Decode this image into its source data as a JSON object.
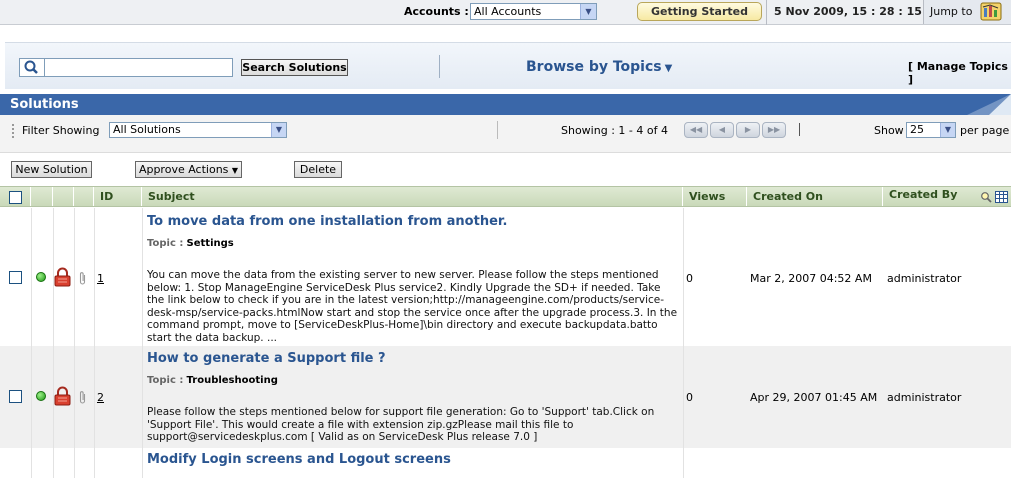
{
  "topbar": {
    "accounts_label": "Accounts :",
    "accounts_value": "All Accounts",
    "getting_started": "Getting Started",
    "datetime": "5 Nov 2009, 15 : 28 : 15",
    "jump_to": "Jump to"
  },
  "search": {
    "placeholder": "",
    "value": "",
    "button": "Search Solutions",
    "browse_topics": "Browse by Topics",
    "manage_topics": "[ Manage Topics ]"
  },
  "solutions": {
    "title": "Solutions"
  },
  "filter": {
    "label": "Filter Showing",
    "value": "All Solutions",
    "showing": "Showing : 1 - 4 of 4",
    "show_label": "Show",
    "per_page_value": "25",
    "per_page_label": "per page"
  },
  "actions": {
    "new_solution": "New Solution",
    "approve_actions": "Approve Actions",
    "delete": "Delete"
  },
  "table": {
    "columns": {
      "id": "ID",
      "subject": "Subject",
      "views": "Views",
      "created_on": "Created On",
      "created_by": "Created By"
    },
    "rows": [
      {
        "id": "1",
        "title": "To move data from one installation from another.",
        "topic_label": "Topic :",
        "topic": "Settings",
        "description": "You can move the data from the existing server to new server. Please follow the steps mentioned below: 1. Stop ManageEngine ServiceDesk Plus service2. Kindly Upgrade the SD+ if needed. Take the link below to check if you are in the latest version;http://manageengine.com/products/service-desk-msp/service-packs.htmlNow start and stop the service once after the upgrade process.3. In the command prompt, move to [ServiceDeskPlus-Home]\\bin directory and execute backupdata.batto start the data backup. ...",
        "views": "0",
        "created_on": "Mar 2, 2007 04:52 AM",
        "created_by": "administrator"
      },
      {
        "id": "2",
        "title": "How to generate a Support file ?",
        "topic_label": "Topic :",
        "topic": "Troubleshooting",
        "description": "Please follow the steps mentioned below for support file generation: Go to 'Support' tab.Click on 'Support File'. This would create a file with extension zip.gzPlease mail this file to support@servicedeskplus.com [ Valid as on ServiceDesk Plus release 7.0 ]",
        "views": "0",
        "created_on": "Apr 29, 2007 01:45 AM",
        "created_by": "administrator"
      },
      {
        "title": "Modify Login screens and Logout screens"
      }
    ]
  },
  "colors": {
    "brand_blue": "#3a67a9",
    "link_blue": "#2a5590",
    "header_green": "#c9d9b9",
    "status_green": "#1f9a16",
    "lock_red": "#c0392b"
  }
}
